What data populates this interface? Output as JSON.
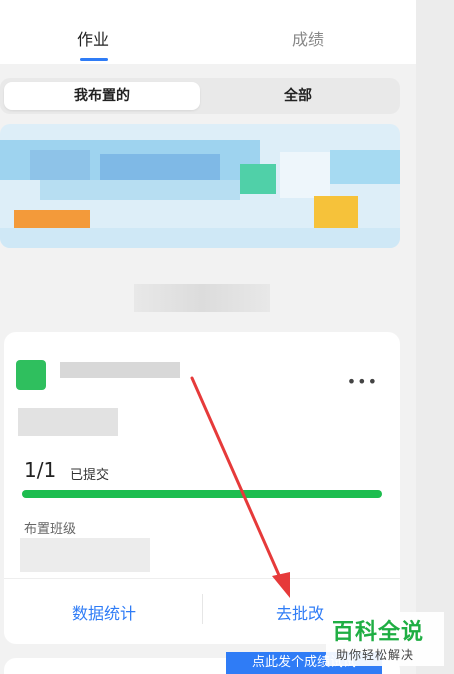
{
  "tabs": [
    {
      "label": "作业",
      "active": true
    },
    {
      "label": "成绩",
      "active": false
    }
  ],
  "segment": {
    "mine": "我布置的",
    "all": "全部"
  },
  "card": {
    "more_icon": "more-dots-icon",
    "submitted_ratio": "1/1",
    "submitted_label": "已提交",
    "progress": 1.0,
    "class_label": "布置班级",
    "action_stats": "数据统计",
    "action_grade": "去批改"
  },
  "hint_bar": "点此发个成绩试试",
  "watermark": {
    "title": "百科全说",
    "subtitle": "助你轻松解决"
  },
  "colors": {
    "accent": "#2f7cf6",
    "progress": "#1dbd4f",
    "annotation_arrow": "#e63a3a"
  }
}
